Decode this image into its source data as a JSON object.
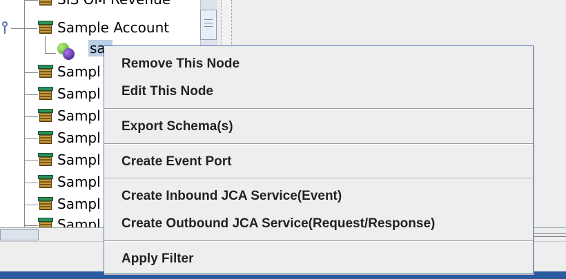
{
  "tree": {
    "top_partial_label": "SIS OM Revenue",
    "sample_account_label": "Sample Account",
    "selected_child_label": "sar",
    "sample_truncated_label": "Sampl",
    "bottom_partial_label": "Sampl"
  },
  "context_menu": {
    "remove_node": "Remove This Node",
    "edit_node": "Edit This Node",
    "export_schema": "Export Schema(s)",
    "create_event_port": "Create Event Port",
    "create_inbound_jca": "Create Inbound JCA Service(Event)",
    "create_outbound_jca": "Create Outbound JCA Service(Request/Response)",
    "apply_filter": "Apply Filter"
  }
}
